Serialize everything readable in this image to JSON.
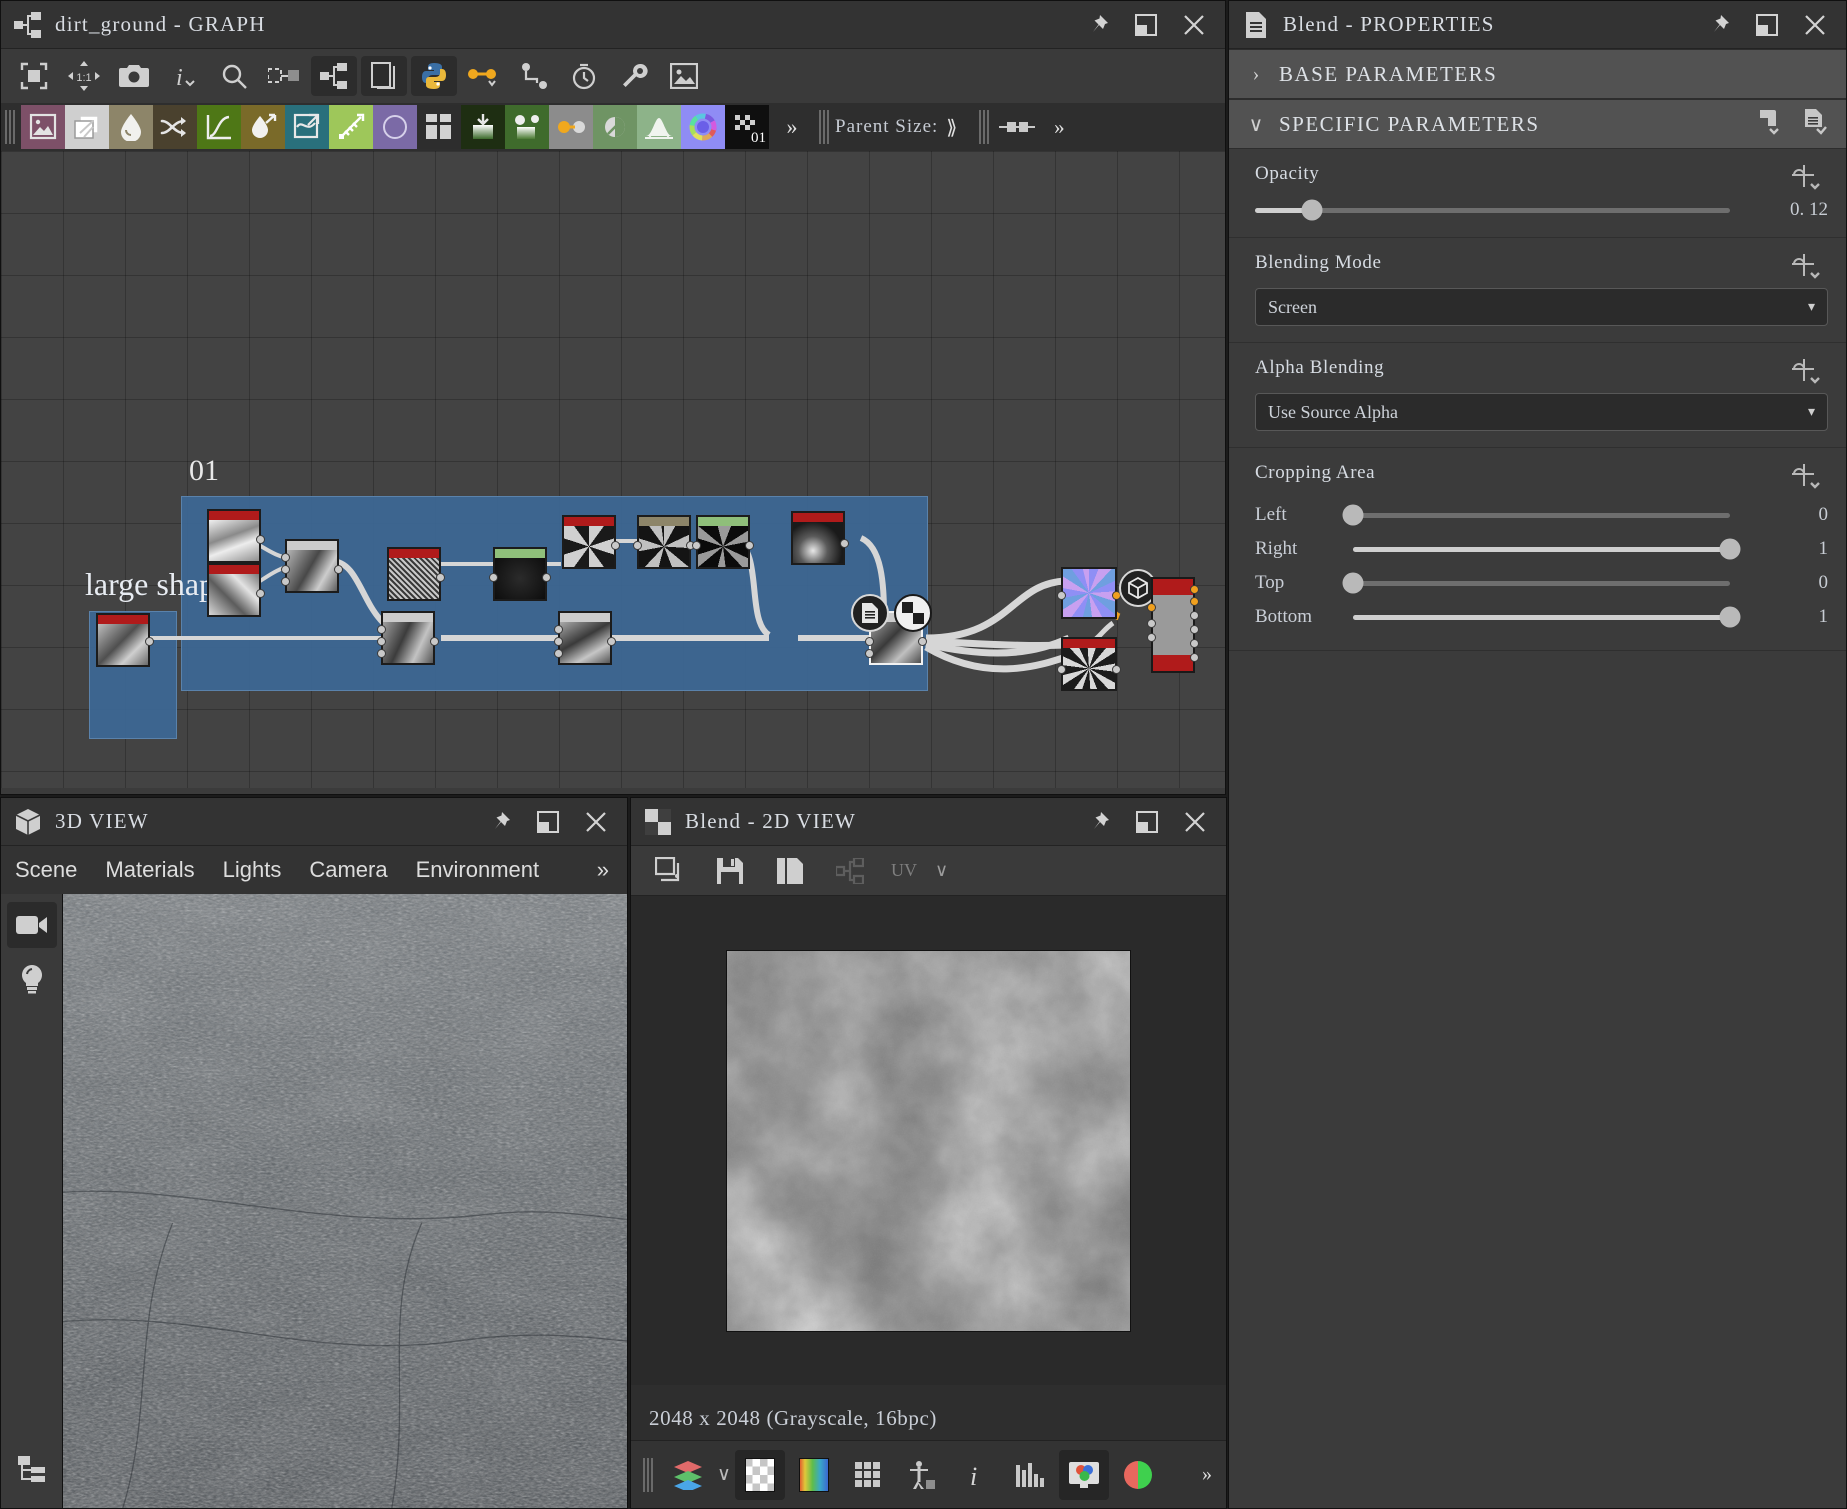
{
  "graph": {
    "title": "dirt_ground - GRAPH",
    "title_icon": "graph-icon",
    "window_buttons": [
      "pin-icon",
      "maximize-icon",
      "close-icon"
    ],
    "toolbar_primary": [
      {
        "name": "frame-all-icon",
        "label": "Frame All"
      },
      {
        "name": "zoom-1-1-icon",
        "label": "1:1"
      },
      {
        "name": "camera-icon",
        "label": "Screenshot"
      },
      {
        "name": "info-icon",
        "label": "Info"
      },
      {
        "name": "search-icon",
        "label": "Search"
      },
      {
        "name": "node-align-icon",
        "label": "Align"
      },
      {
        "name": "graph-icon",
        "label": "Graph"
      },
      {
        "name": "layers-icon",
        "label": "Layers"
      },
      {
        "name": "python-icon",
        "label": "Python"
      },
      {
        "name": "link-dot-icon",
        "label": "Connections"
      },
      {
        "name": "node-path-icon",
        "label": "Paths"
      },
      {
        "name": "timer-icon",
        "label": "Timing"
      },
      {
        "name": "wrench-icon",
        "label": "Tools"
      },
      {
        "name": "image-icon",
        "label": "Preview"
      }
    ],
    "library_icons": [
      {
        "name": "bitmap-icon",
        "color": "#7d5068"
      },
      {
        "name": "blend-icon",
        "color": "#cfcfcf"
      },
      {
        "name": "blur-icon",
        "color": "#8d8569"
      },
      {
        "name": "shuffle-icon",
        "color": "#4a412e"
      },
      {
        "name": "curve-icon",
        "color": "#4e7716"
      },
      {
        "name": "directional-blur-icon",
        "color": "#7a6a29"
      },
      {
        "name": "warp-icon",
        "color": "#29707c"
      },
      {
        "name": "gradient-icon",
        "color": "#9ec75a"
      },
      {
        "name": "shape-icon",
        "color": "#7b6aa6"
      },
      {
        "name": "tile-generator-icon",
        "color": "#2d2d2d"
      },
      {
        "name": "gradient-map-icon",
        "color": "#1e2e12"
      },
      {
        "name": "splatter-icon",
        "color": "#3f6b2c"
      },
      {
        "name": "value-processor-icon",
        "color": "#8c8c8c"
      },
      {
        "name": "levels-icon",
        "color": "#6f9464"
      },
      {
        "name": "histogram-icon",
        "color": "#8db389"
      },
      {
        "name": "color-wheel-icon",
        "color": "#8f8cf5"
      },
      {
        "name": "alpha-merge-icon",
        "color": "#0f0f0f",
        "badge": "01"
      }
    ],
    "overflow_label": "»",
    "parent_size_label": "Parent Size:",
    "parent_size_chevron": "⟫",
    "frame": {
      "label": "01"
    },
    "annotation": "large shapes"
  },
  "properties": {
    "title": "Blend - PROPERTIES",
    "title_icon": "document-icon",
    "window_buttons": [
      "pin-icon",
      "maximize-icon",
      "close-icon"
    ],
    "sections": [
      {
        "label": "BASE PARAMETERS",
        "expanded": false,
        "chevron": "›"
      },
      {
        "label": "SPECIFIC PARAMETERS",
        "expanded": true,
        "chevron": "∨"
      }
    ],
    "section_actions": [
      "preset-save-icon",
      "preset-load-icon"
    ],
    "opacity": {
      "label": "Opacity",
      "value": "0. 12",
      "percent": 12,
      "fn_icon": "function-icon"
    },
    "blending_mode": {
      "label": "Blending Mode",
      "value": "Screen",
      "fn_icon": "function-icon",
      "chevron": "▾"
    },
    "alpha_blending": {
      "label": "Alpha Blending",
      "value": "Use Source Alpha",
      "fn_icon": "function-icon",
      "chevron": "▾"
    },
    "cropping_area": {
      "label": "Cropping Area",
      "fn_icon": "function-icon",
      "rows": [
        {
          "name": "Left",
          "value": "0",
          "percent": 0
        },
        {
          "name": "Right",
          "value": "1",
          "percent": 100
        },
        {
          "name": "Top",
          "value": "0",
          "percent": 0
        },
        {
          "name": "Bottom",
          "value": "1",
          "percent": 100
        }
      ]
    }
  },
  "view3d": {
    "title": "3D VIEW",
    "title_icon": "cube-icon",
    "window_buttons": [
      "pin-icon",
      "maximize-icon",
      "close-icon"
    ],
    "tabs": [
      "Scene",
      "Materials",
      "Lights",
      "Camera",
      "Environment"
    ],
    "tabs_overflow": "»",
    "side_buttons": [
      {
        "name": "camera-icon",
        "active": true
      },
      {
        "name": "light-bulb-icon",
        "active": false
      }
    ],
    "bottom_button": {
      "name": "hierarchy-icon"
    }
  },
  "view2d": {
    "title": "Blend - 2D VIEW",
    "title_icon": "checker-icon",
    "window_buttons": [
      "pin-icon",
      "maximize-icon",
      "close-icon"
    ],
    "toolbar": [
      {
        "name": "copy-view-icon"
      },
      {
        "name": "save-icon"
      },
      {
        "name": "duplicate-icon"
      },
      {
        "name": "graph-icon"
      },
      {
        "name": "uv-label",
        "label": "UV"
      },
      {
        "name": "chevron-down-icon",
        "label": "∨"
      }
    ],
    "info": "2048 x 2048 (Grayscale, 16bpc)",
    "bottom_bar": [
      {
        "name": "layers-icon",
        "active": false
      },
      {
        "name": "chevron-down-icon",
        "active": false,
        "label": "∨"
      },
      {
        "name": "checker-background-icon",
        "active": true
      },
      {
        "name": "color-spectrum-icon",
        "active": true
      },
      {
        "name": "tiling-grid-icon",
        "active": false
      },
      {
        "name": "scale-reference-icon",
        "active": false
      },
      {
        "name": "info-icon",
        "active": false
      },
      {
        "name": "histogram-icon",
        "active": false
      },
      {
        "name": "display-color-icon",
        "active": true
      },
      {
        "name": "channel-split-icon",
        "active": false
      }
    ],
    "bottom_overflow": "»"
  },
  "colors": {
    "accent_blue": "#3d6896",
    "node_red": "#b01b1b",
    "node_green": "#8fbf7a",
    "node_tan": "#8d8569",
    "wire": "#d8d8d8",
    "wire_alpha": "#f0a01e",
    "panel_bg": "#3b3b3b",
    "title_bg": "#333333"
  }
}
